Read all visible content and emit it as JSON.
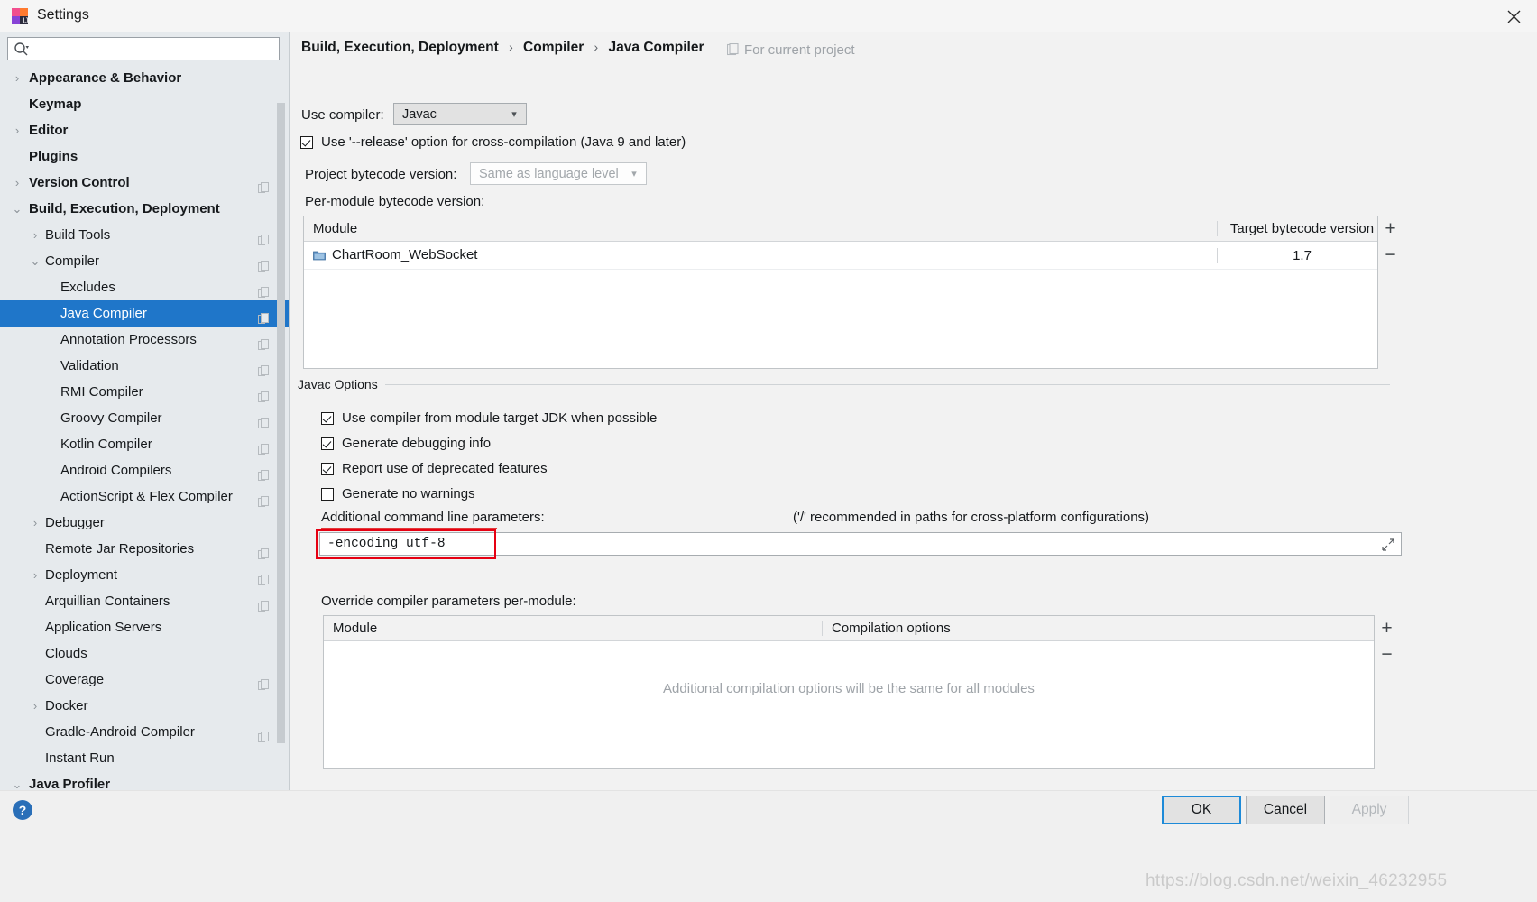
{
  "window": {
    "title": "Settings",
    "app_icon": "intellij-idea-icon",
    "close_label": "✕"
  },
  "search": {
    "placeholder": "",
    "value": "",
    "icon": "search-icon"
  },
  "sidebar": {
    "items": [
      {
        "label": "Appearance & Behavior",
        "level": 0,
        "arrow": "›",
        "bold": true,
        "copy": false,
        "selected": false
      },
      {
        "label": "Keymap",
        "level": 0,
        "arrow": "",
        "bold": true,
        "copy": false,
        "selected": false
      },
      {
        "label": "Editor",
        "level": 0,
        "arrow": "›",
        "bold": true,
        "copy": false,
        "selected": false
      },
      {
        "label": "Plugins",
        "level": 0,
        "arrow": "",
        "bold": true,
        "copy": false,
        "selected": false
      },
      {
        "label": "Version Control",
        "level": 0,
        "arrow": "›",
        "bold": true,
        "copy": true,
        "selected": false
      },
      {
        "label": "Build, Execution, Deployment",
        "level": 0,
        "arrow": "⌄",
        "bold": true,
        "copy": false,
        "selected": false
      },
      {
        "label": "Build Tools",
        "level": 1,
        "arrow": "›",
        "bold": false,
        "copy": true,
        "selected": false
      },
      {
        "label": "Compiler",
        "level": 1,
        "arrow": "⌄",
        "bold": false,
        "copy": true,
        "selected": false
      },
      {
        "label": "Excludes",
        "level": 2,
        "arrow": "",
        "bold": false,
        "copy": true,
        "selected": false
      },
      {
        "label": "Java Compiler",
        "level": 2,
        "arrow": "",
        "bold": false,
        "copy": true,
        "selected": true
      },
      {
        "label": "Annotation Processors",
        "level": 2,
        "arrow": "",
        "bold": false,
        "copy": true,
        "selected": false
      },
      {
        "label": "Validation",
        "level": 2,
        "arrow": "",
        "bold": false,
        "copy": true,
        "selected": false
      },
      {
        "label": "RMI Compiler",
        "level": 2,
        "arrow": "",
        "bold": false,
        "copy": true,
        "selected": false
      },
      {
        "label": "Groovy Compiler",
        "level": 2,
        "arrow": "",
        "bold": false,
        "copy": true,
        "selected": false
      },
      {
        "label": "Kotlin Compiler",
        "level": 2,
        "arrow": "",
        "bold": false,
        "copy": true,
        "selected": false
      },
      {
        "label": "Android Compilers",
        "level": 2,
        "arrow": "",
        "bold": false,
        "copy": true,
        "selected": false
      },
      {
        "label": "ActionScript & Flex Compiler",
        "level": 2,
        "arrow": "",
        "bold": false,
        "copy": true,
        "selected": false
      },
      {
        "label": "Debugger",
        "level": 1,
        "arrow": "›",
        "bold": false,
        "copy": false,
        "selected": false
      },
      {
        "label": "Remote Jar Repositories",
        "level": 1,
        "arrow": "",
        "bold": false,
        "copy": true,
        "selected": false
      },
      {
        "label": "Deployment",
        "level": 1,
        "arrow": "›",
        "bold": false,
        "copy": true,
        "selected": false
      },
      {
        "label": "Arquillian Containers",
        "level": 1,
        "arrow": "",
        "bold": false,
        "copy": true,
        "selected": false
      },
      {
        "label": "Application Servers",
        "level": 1,
        "arrow": "",
        "bold": false,
        "copy": false,
        "selected": false
      },
      {
        "label": "Clouds",
        "level": 1,
        "arrow": "",
        "bold": false,
        "copy": false,
        "selected": false
      },
      {
        "label": "Coverage",
        "level": 1,
        "arrow": "",
        "bold": false,
        "copy": true,
        "selected": false
      },
      {
        "label": "Docker",
        "level": 1,
        "arrow": "›",
        "bold": false,
        "copy": false,
        "selected": false
      },
      {
        "label": "Gradle-Android Compiler",
        "level": 1,
        "arrow": "",
        "bold": false,
        "copy": true,
        "selected": false
      },
      {
        "label": "Instant Run",
        "level": 1,
        "arrow": "",
        "bold": false,
        "copy": false,
        "selected": false
      },
      {
        "label": "Java Profiler",
        "level": 0,
        "arrow": "⌄",
        "bold": false,
        "copy": false,
        "selected": false
      }
    ]
  },
  "main": {
    "breadcrumb": {
      "part1": "Build, Execution, Deployment",
      "part2": "Compiler",
      "part3": "Java Compiler",
      "separator": "›"
    },
    "for_current_project": "For current project",
    "use_compiler_label": "Use compiler:",
    "use_compiler_value": "Javac",
    "release_option_label": "Use '--release' option for cross-compilation (Java 9 and later)",
    "release_option_checked": true,
    "project_bytecode_label": "Project bytecode version:",
    "project_bytecode_value": "Same as language level",
    "per_module_label": "Per-module bytecode version:",
    "module_table": {
      "headers": [
        "Module",
        "Target bytecode version"
      ],
      "rows": [
        {
          "module": "ChartRoom_WebSocket",
          "target": "1.7"
        }
      ],
      "add_label": "+",
      "remove_label": "−"
    },
    "javac_options": {
      "group_title": "Javac Options",
      "checkboxes": [
        {
          "label": "Use compiler from module target JDK when possible",
          "checked": true
        },
        {
          "label": "Generate debugging info",
          "checked": true
        },
        {
          "label": "Report use of deprecated features",
          "checked": true
        },
        {
          "label": "Generate no warnings",
          "checked": false
        }
      ],
      "additional_params_label": "Additional command line parameters:",
      "additional_params_hint": "('/' recommended in paths for cross-platform configurations)",
      "additional_params_value": "-encoding utf-8"
    },
    "override_label": "Override compiler parameters per-module:",
    "override_table": {
      "headers": [
        "Module",
        "Compilation options"
      ],
      "empty_message": "Additional compilation options will be the same for all modules",
      "add_label": "+",
      "remove_label": "−"
    }
  },
  "footer": {
    "help_label": "?",
    "ok_label": "OK",
    "cancel_label": "Cancel",
    "apply_label": "Apply",
    "watermark": "https://blog.csdn.net/weixin_46232955"
  },
  "colors": {
    "accent": "#1f76c9",
    "selection": "#1f76c9",
    "annotation_red": "#e60012",
    "panel_bg": "#f2f2f2",
    "sidebar_bg": "#e6eaed"
  }
}
